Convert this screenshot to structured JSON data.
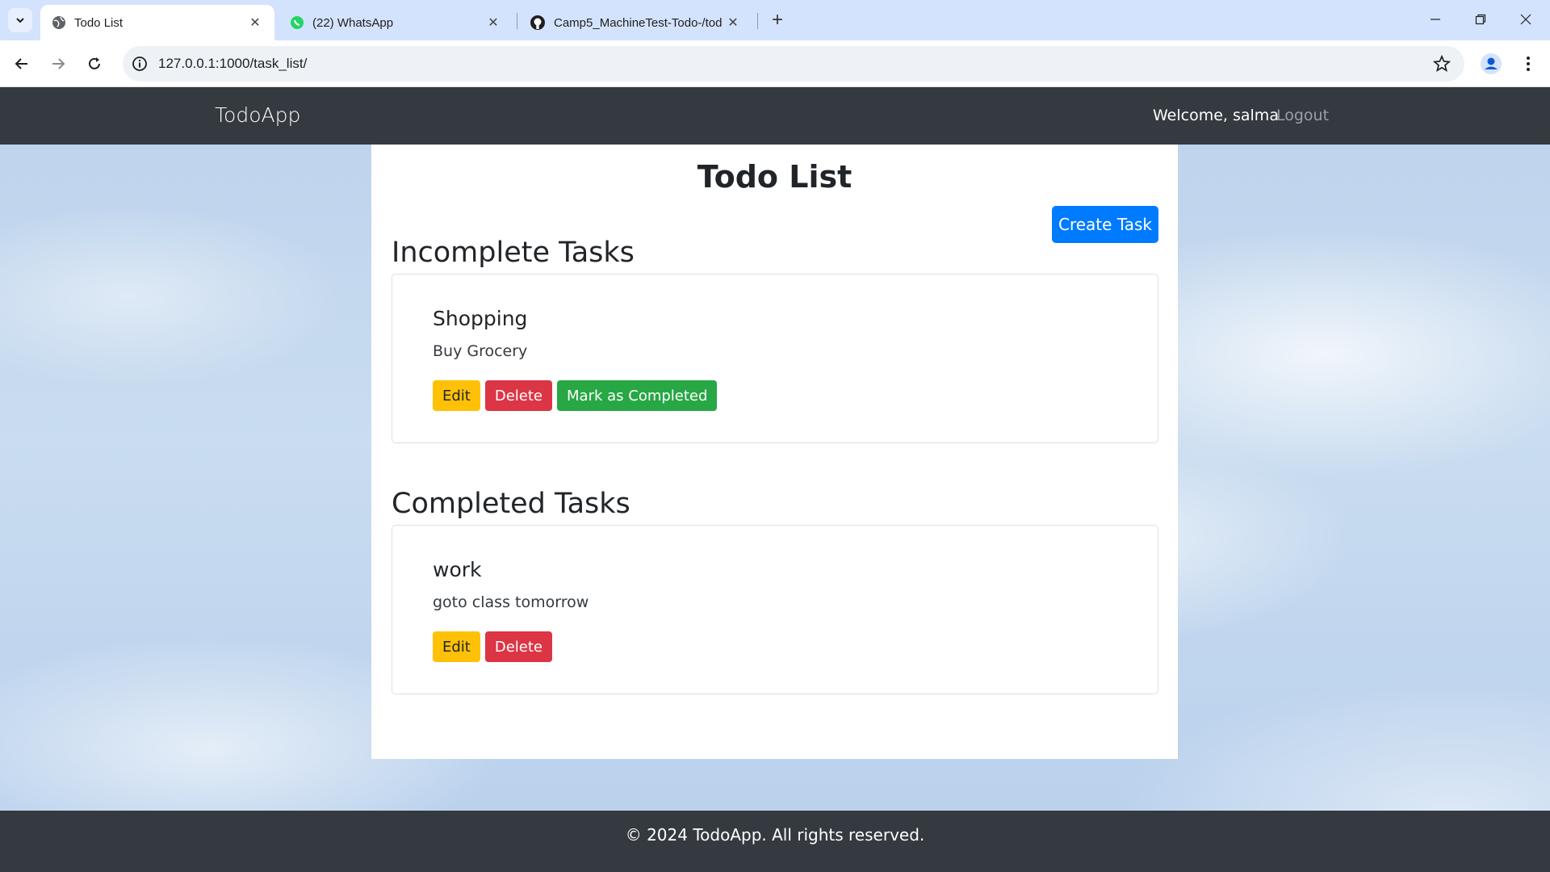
{
  "browser": {
    "tabs": [
      {
        "title": "Todo List",
        "icon": "globe-icon",
        "active": true
      },
      {
        "title": "(22) WhatsApp",
        "icon": "whatsapp-icon",
        "active": false
      },
      {
        "title": "Camp5_MachineTest-Todo-/tod",
        "icon": "github-icon",
        "active": false
      }
    ],
    "url": "127.0.0.1:1000/task_list/"
  },
  "navbar": {
    "brand": "TodoApp",
    "welcome": "Welcome, salma",
    "logout": "Logout"
  },
  "main": {
    "title": "Todo List",
    "create_button": "Create Task",
    "incomplete": {
      "heading": "Incomplete Tasks",
      "tasks": [
        {
          "title": "Shopping",
          "description": "Buy Grocery",
          "edit": "Edit",
          "delete": "Delete",
          "complete": "Mark as Completed"
        }
      ]
    },
    "completed": {
      "heading": "Completed Tasks",
      "tasks": [
        {
          "title": "work",
          "description": "goto class tomorrow",
          "edit": "Edit",
          "delete": "Delete"
        }
      ]
    }
  },
  "footer": {
    "text": "© 2024 TodoApp. All rights reserved."
  },
  "colors": {
    "navbar": "#343a40",
    "primary": "#007bff",
    "warning": "#ffc107",
    "danger": "#dc3545",
    "success": "#28a745"
  }
}
